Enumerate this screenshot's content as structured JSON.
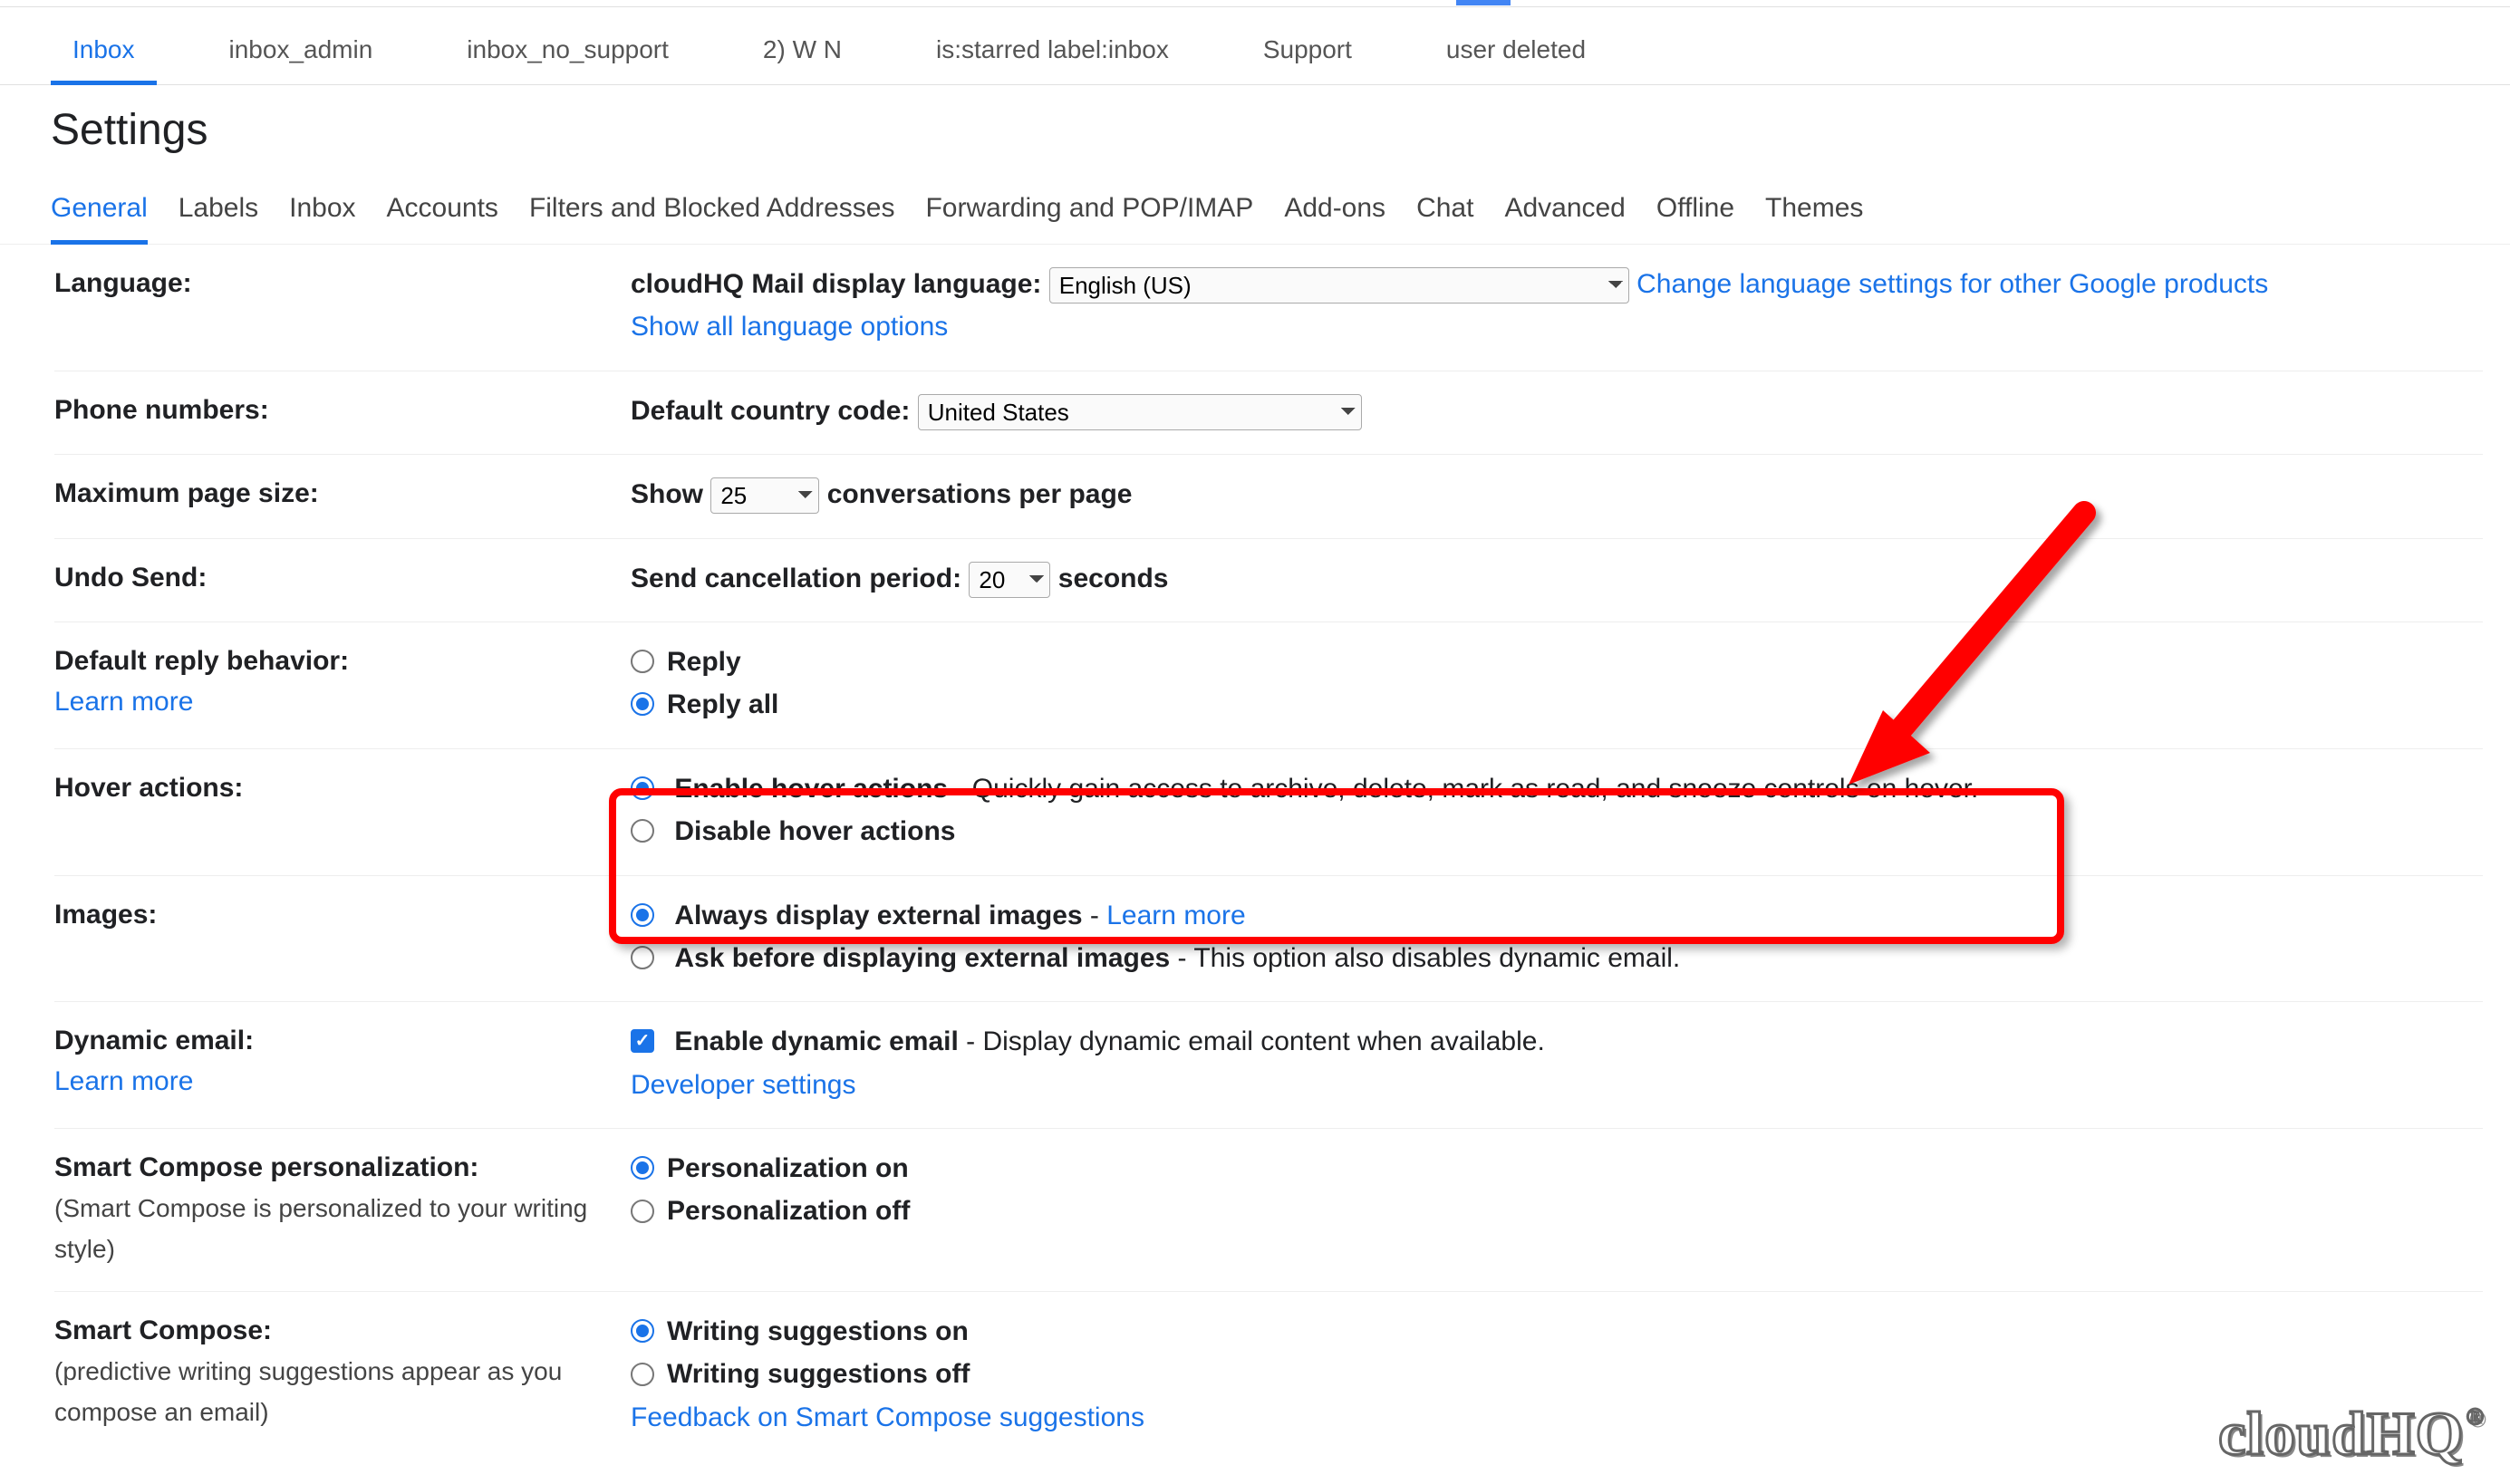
{
  "top_tabs": [
    {
      "label": "Inbox",
      "active": true
    },
    {
      "label": "inbox_admin"
    },
    {
      "label": "inbox_no_support"
    },
    {
      "label": "2) W N"
    },
    {
      "label": "is:starred label:inbox"
    },
    {
      "label": "Support"
    },
    {
      "label": "user deleted"
    }
  ],
  "page_title": "Settings",
  "settings_tabs": [
    "General",
    "Labels",
    "Inbox",
    "Accounts",
    "Filters and Blocked Addresses",
    "Forwarding and POP/IMAP",
    "Add-ons",
    "Chat",
    "Advanced",
    "Offline",
    "Themes"
  ],
  "language": {
    "row_label": "Language:",
    "prompt": "cloudHQ Mail display language:",
    "value": "English (US)",
    "link": "Change language settings for other Google products",
    "show_all": "Show all language options"
  },
  "phone": {
    "row_label": "Phone numbers:",
    "prompt": "Default country code:",
    "value": "United States"
  },
  "page_size": {
    "row_label": "Maximum page size:",
    "pre": "Show",
    "value": "25",
    "post": "conversations per page"
  },
  "undo": {
    "row_label": "Undo Send:",
    "prompt": "Send cancellation period:",
    "value": "20",
    "post": "seconds"
  },
  "reply": {
    "row_label": "Default reply behavior:",
    "learn": "Learn more",
    "opt1": "Reply",
    "opt2": "Reply all"
  },
  "hover": {
    "row_label": "Hover actions:",
    "opt1": "Enable hover actions",
    "desc1": " - Quickly gain access to archive, delete, mark as read, and snooze controls on hover.",
    "opt2": "Disable hover actions"
  },
  "images": {
    "row_label": "Images:",
    "opt1": "Always display external images",
    "learn": "Learn more",
    "opt2": "Ask before displaying external images",
    "desc2": " - This option also disables dynamic email."
  },
  "dynamic": {
    "row_label": "Dynamic email:",
    "learn": "Learn more",
    "opt": "Enable dynamic email",
    "desc": " - Display dynamic email content when available.",
    "dev": "Developer settings"
  },
  "smart_personal": {
    "row_label": "Smart Compose personalization:",
    "sub": "(Smart Compose is personalized to your writing style)",
    "opt1": "Personalization on",
    "opt2": "Personalization off"
  },
  "smart_compose": {
    "row_label": "Smart Compose:",
    "sub": "(predictive writing suggestions appear as you compose an email)",
    "opt1": "Writing suggestions on",
    "opt2": "Writing suggestions off",
    "feedback": "Feedback on Smart Compose suggestions"
  },
  "watermark": "cloudHQ"
}
